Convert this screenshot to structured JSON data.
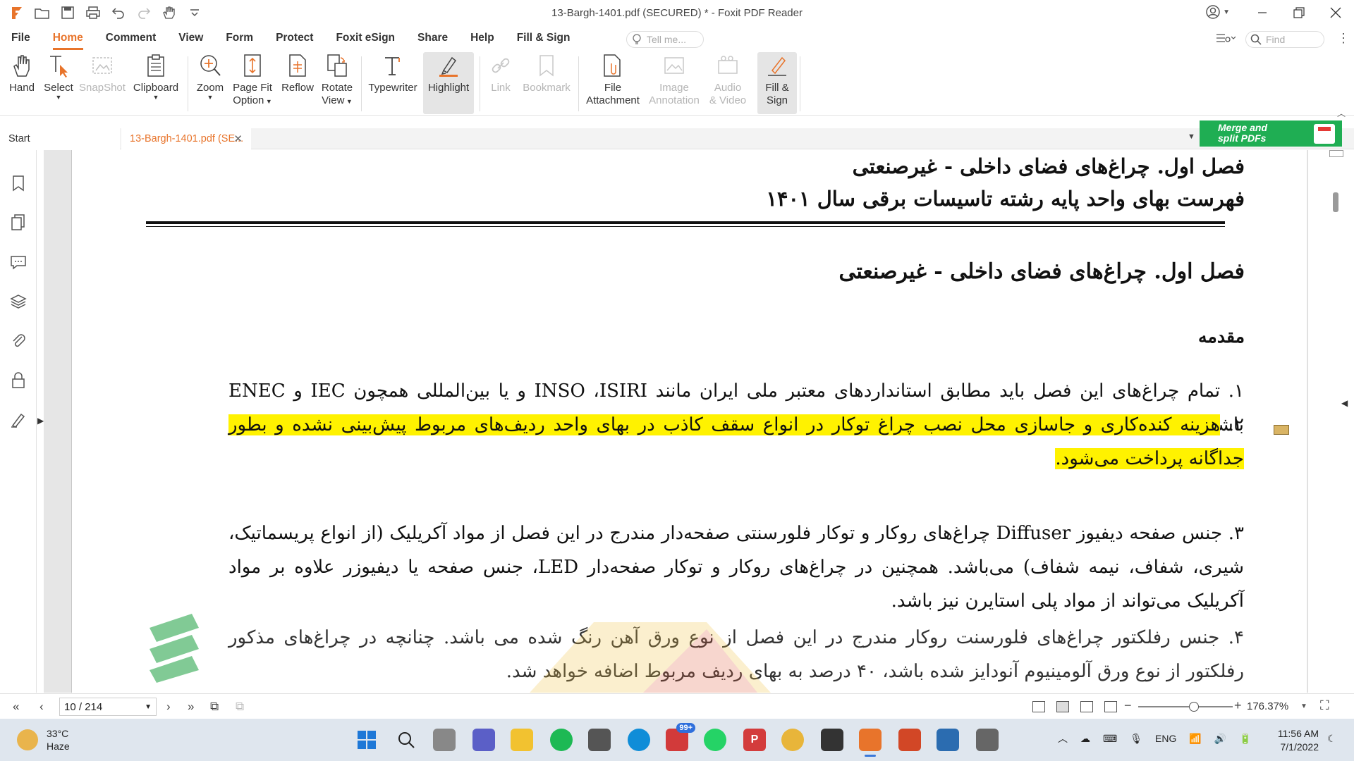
{
  "window": {
    "title": "13-Bargh-1401.pdf (SECURED) * - Foxit PDF Reader",
    "brand_color": "#e8742b"
  },
  "menu": {
    "tabs": [
      "File",
      "Home",
      "Comment",
      "View",
      "Form",
      "Protect",
      "Foxit eSign",
      "Share",
      "Help",
      "Fill & Sign"
    ],
    "active": "Home",
    "tell_me_placeholder": "Tell me...",
    "find_placeholder": "Find"
  },
  "ribbon": {
    "hand": "Hand",
    "select": "Select",
    "snapshot": "SnapShot",
    "clipboard": "Clipboard",
    "zoom": "Zoom",
    "page_fit_1": "Page Fit",
    "page_fit_2": "Option",
    "reflow": "Reflow",
    "rotate_1": "Rotate",
    "rotate_2": "View",
    "typewriter": "Typewriter",
    "highlight": "Highlight",
    "link": "Link",
    "bookmark": "Bookmark",
    "file_att_1": "File",
    "file_att_2": "Attachment",
    "image_ann_1": "Image",
    "image_ann_2": "Annotation",
    "audio_1": "Audio",
    "audio_2": "& Video",
    "fillsign_1": "Fill &",
    "fillsign_2": "Sign"
  },
  "tabs": {
    "start": "Start",
    "file": "13-Bargh-1401.pdf (SE...",
    "ad_line1": "Merge and",
    "ad_line2": "split PDFs"
  },
  "document": {
    "header1": "فصل اول. چراغ‌های فضای داخلی - غیرصنعتی",
    "header2": "فهرست بهای واحد پایه رشته تاسیسات برقی سال ۱۴۰۱",
    "heading": "فصل اول. چراغ‌های فضای داخلی - غیرصنعتی",
    "intro": "مقدمه",
    "p1": "۱. تمام چراغ‌های این فصل باید مطابق استانداردهای معتبر ملی ایران مانند INSO ،ISIRI و یا بین‌المللی همچون IEC و ENEC باشند.",
    "p2_num": "۲. ",
    "p2_text": "هزینه کنده‌کاری و جاسازی محل نصب چراغ توکار در انواع سقف کاذب در بهای واحد ردیف‌های مربوط پیش‌بینی نشده و بطور جداگانه پرداخت می‌شود.",
    "p3": "۳. جنس صفحه دیفیوز Diffuser چراغ‌های روکار و توکار فلورسنتی صفحه‌دار مندرج در این فصل از مواد آکریلیک (از انواع پریسماتیک، شیری، شفاف، نیمه شفاف) می‌باشد. همچنین در چراغ‌های روکار و توکار صفحه‌دار LED، جنس صفحه یا دیفیوزر علاوه بر مواد آکریلیک می‌تواند از مواد پلی استایرن نیز باشد.",
    "p4": "۴. جنس رفلکتور چراغ‌های فلورسنت روکار مندرج در این فصل از نوع ورق آهن رنگ شده می باشد. چنانچه در چراغ‌های مذکور رفلکتور از نوع ورق آلومینیوم آنودایز شده باشد، ۴۰ درصد به بهای ردیف مربوط اضافه خواهد شد."
  },
  "status": {
    "page": "10 / 214",
    "zoom": "176.37%"
  },
  "taskbar": {
    "temp": "33°C",
    "weather": "Haze",
    "mail_badge": "99+",
    "lang": "ENG",
    "time": "11:56 AM",
    "date": "7/1/2022"
  }
}
